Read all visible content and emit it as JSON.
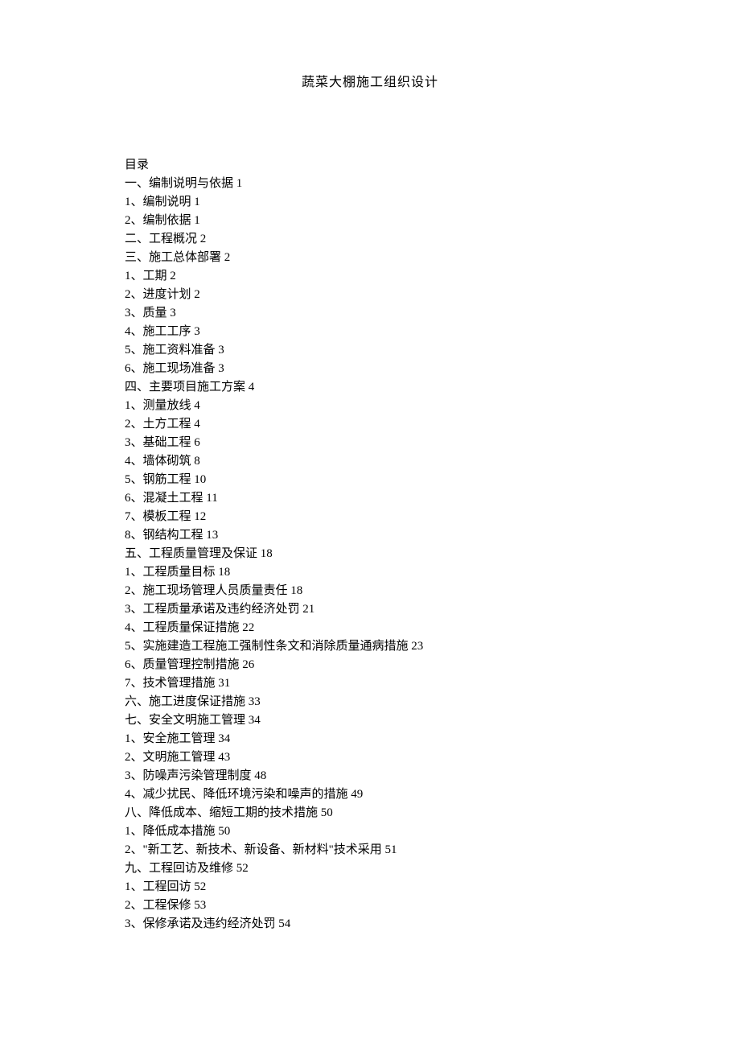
{
  "title": "蔬菜大棚施工组织设计",
  "toc_heading": "目录",
  "toc": [
    "一、编制说明与依据 1",
    "1、编制说明 1",
    "2、编制依据 1",
    "二、工程概况 2",
    "三、施工总体部署 2",
    "1、工期 2",
    "2、进度计划 2",
    "3、质量 3",
    "4、施工工序 3",
    "5、施工资料准备 3",
    "6、施工现场准备 3",
    "四、主要项目施工方案 4",
    "1、测量放线 4",
    "2、土方工程 4",
    "3、基础工程 6",
    "4、墙体砌筑 8",
    "5、钢筋工程 10",
    "6、混凝土工程 11",
    "7、模板工程 12",
    "8、钢结构工程 13",
    "五、工程质量管理及保证 18",
    "1、工程质量目标 18",
    "2、施工现场管理人员质量责任 18",
    "3、工程质量承诺及违约经济处罚 21",
    "4、工程质量保证措施 22",
    "5、实施建造工程施工强制性条文和消除质量通病措施 23",
    "6、质量管理控制措施 26",
    "7、技术管理措施 31",
    "六、施工进度保证措施 33",
    "七、安全文明施工管理 34",
    "1、安全施工管理 34",
    "2、文明施工管理 43",
    "3、防噪声污染管理制度 48",
    "4、减少扰民、降低环境污染和噪声的措施 49",
    "八、降低成本、缩短工期的技术措施 50",
    "1、降低成本措施 50",
    "2、\"新工艺、新技术、新设备、新材料\"技术采用 51",
    "九、工程回访及维修 52",
    "1、工程回访 52",
    "2、工程保修 53",
    "3、保修承诺及违约经济处罚 54"
  ]
}
